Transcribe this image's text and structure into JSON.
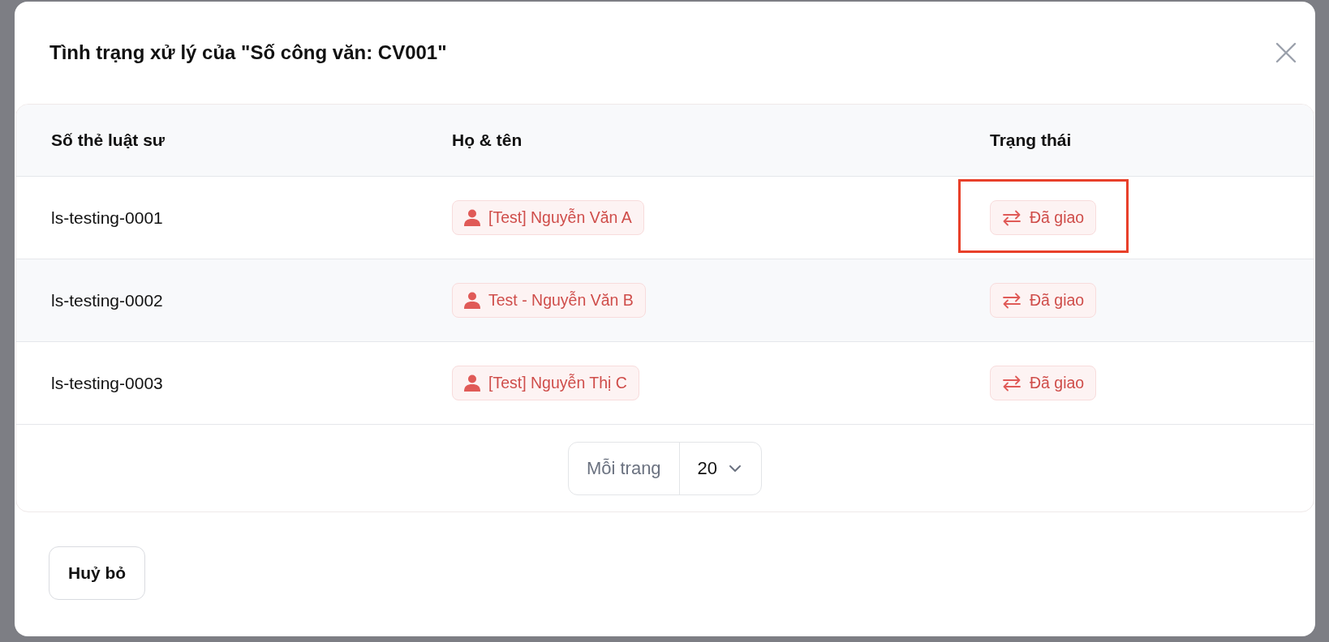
{
  "dialog": {
    "title": "Tình trạng xử lý của \"Số công văn: CV001\""
  },
  "table": {
    "columns": [
      "Số thẻ luật sư",
      "Họ & tên",
      "Trạng thái"
    ],
    "rows": [
      {
        "card_number": "ls-testing-0001",
        "name": "[Test] Nguyễn Văn A",
        "status": "Đã giao",
        "highlighted": true
      },
      {
        "card_number": "ls-testing-0002",
        "name": "Test - Nguyễn Văn B",
        "status": "Đã giao",
        "highlighted": false
      },
      {
        "card_number": "ls-testing-0003",
        "name": "[Test] Nguyễn Thị C",
        "status": "Đã giao",
        "highlighted": false
      }
    ]
  },
  "pagination": {
    "label": "Mỗi trang",
    "page_size": "20"
  },
  "buttons": [
    "Huỷ bỏ"
  ]
}
